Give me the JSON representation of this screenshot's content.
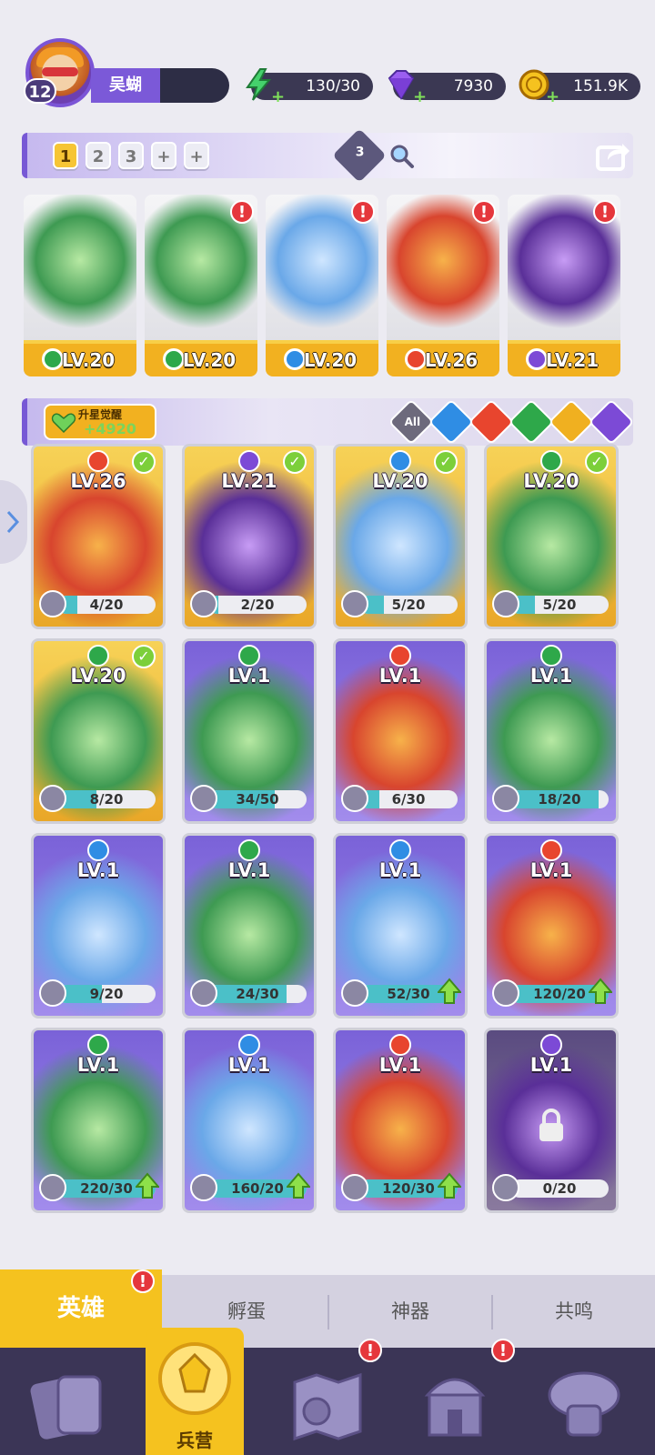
{
  "player": {
    "level": "12",
    "name": "吴蝴"
  },
  "resources": {
    "energy": "130/30",
    "gems": "7930",
    "coins": "151.9K"
  },
  "teams": {
    "slots": [
      "1",
      "2",
      "3",
      "+",
      "+"
    ],
    "active": "1",
    "badge_count": "3"
  },
  "featured": [
    {
      "level": "LV.20",
      "element": "wind",
      "alert": false
    },
    {
      "level": "LV.20",
      "element": "wind",
      "alert": true
    },
    {
      "level": "LV.20",
      "element": "water",
      "alert": true
    },
    {
      "level": "LV.26",
      "element": "fire",
      "alert": true
    },
    {
      "level": "LV.21",
      "element": "dark",
      "alert": true
    }
  ],
  "awaken": {
    "title": "升星觉醒",
    "value": "+4920"
  },
  "filters": [
    "All",
    "water",
    "fire",
    "wind",
    "light",
    "dark"
  ],
  "heroes": [
    {
      "level": "LV.26",
      "element": "fire",
      "progress": "4/20",
      "ratio": 0.2,
      "frame": "gold",
      "check": true,
      "upgrade": false
    },
    {
      "level": "LV.21",
      "element": "dark",
      "progress": "2/20",
      "ratio": 0.1,
      "frame": "gold",
      "check": true,
      "upgrade": false
    },
    {
      "level": "LV.20",
      "element": "water",
      "progress": "5/20",
      "ratio": 0.25,
      "frame": "gold",
      "check": true,
      "upgrade": false
    },
    {
      "level": "LV.20",
      "element": "wind",
      "progress": "5/20",
      "ratio": 0.25,
      "frame": "gold",
      "check": true,
      "upgrade": false
    },
    {
      "level": "LV.20",
      "element": "wind",
      "progress": "8/20",
      "ratio": 0.4,
      "frame": "gold",
      "check": true,
      "upgrade": false
    },
    {
      "level": "LV.1",
      "element": "wind",
      "progress": "34/50",
      "ratio": 0.68,
      "frame": "purple",
      "check": false,
      "upgrade": false
    },
    {
      "level": "LV.1",
      "element": "fire",
      "progress": "6/30",
      "ratio": 0.2,
      "frame": "purple",
      "check": false,
      "upgrade": false
    },
    {
      "level": "LV.1",
      "element": "wind",
      "progress": "18/20",
      "ratio": 0.9,
      "frame": "purple",
      "check": false,
      "upgrade": false
    },
    {
      "level": "LV.1",
      "element": "water",
      "progress": "9/20",
      "ratio": 0.45,
      "frame": "purple",
      "check": false,
      "upgrade": false
    },
    {
      "level": "LV.1",
      "element": "wind",
      "progress": "24/30",
      "ratio": 0.8,
      "frame": "purple",
      "check": false,
      "upgrade": false
    },
    {
      "level": "LV.1",
      "element": "water",
      "progress": "52/30",
      "ratio": 1,
      "frame": "purple",
      "check": false,
      "upgrade": true
    },
    {
      "level": "LV.1",
      "element": "fire",
      "progress": "120/20",
      "ratio": 1,
      "frame": "purple",
      "check": false,
      "upgrade": true
    },
    {
      "level": "LV.1",
      "element": "wind",
      "progress": "220/30",
      "ratio": 1,
      "frame": "purple",
      "check": false,
      "upgrade": true
    },
    {
      "level": "LV.1",
      "element": "water",
      "progress": "160/20",
      "ratio": 1,
      "frame": "purple",
      "check": false,
      "upgrade": true
    },
    {
      "level": "LV.1",
      "element": "fire",
      "progress": "120/30",
      "ratio": 1,
      "frame": "purple",
      "check": false,
      "upgrade": true
    },
    {
      "level": "LV.1",
      "element": "dark",
      "progress": "0/20",
      "ratio": 0,
      "frame": "dark",
      "check": false,
      "upgrade": false,
      "locked": true
    }
  ],
  "tabs": [
    {
      "label": "英雄",
      "active": true,
      "alert": true
    },
    {
      "label": "孵蛋",
      "active": false
    },
    {
      "label": "神器",
      "active": false
    },
    {
      "label": "共鸣",
      "active": false
    }
  ],
  "nav": {
    "items": [
      "cards-icon",
      "barracks-icon",
      "map-icon",
      "temple-icon",
      "guild-icon"
    ],
    "selected_label": "兵营",
    "alerts": [
      "map-icon",
      "temple-icon"
    ]
  },
  "colors": {
    "fire": "#e8452e",
    "water": "#2f8de4",
    "wind": "#2ea84a",
    "light": "#f0b020",
    "dark": "#7c4ad6",
    "accent": "#f5c21f"
  }
}
